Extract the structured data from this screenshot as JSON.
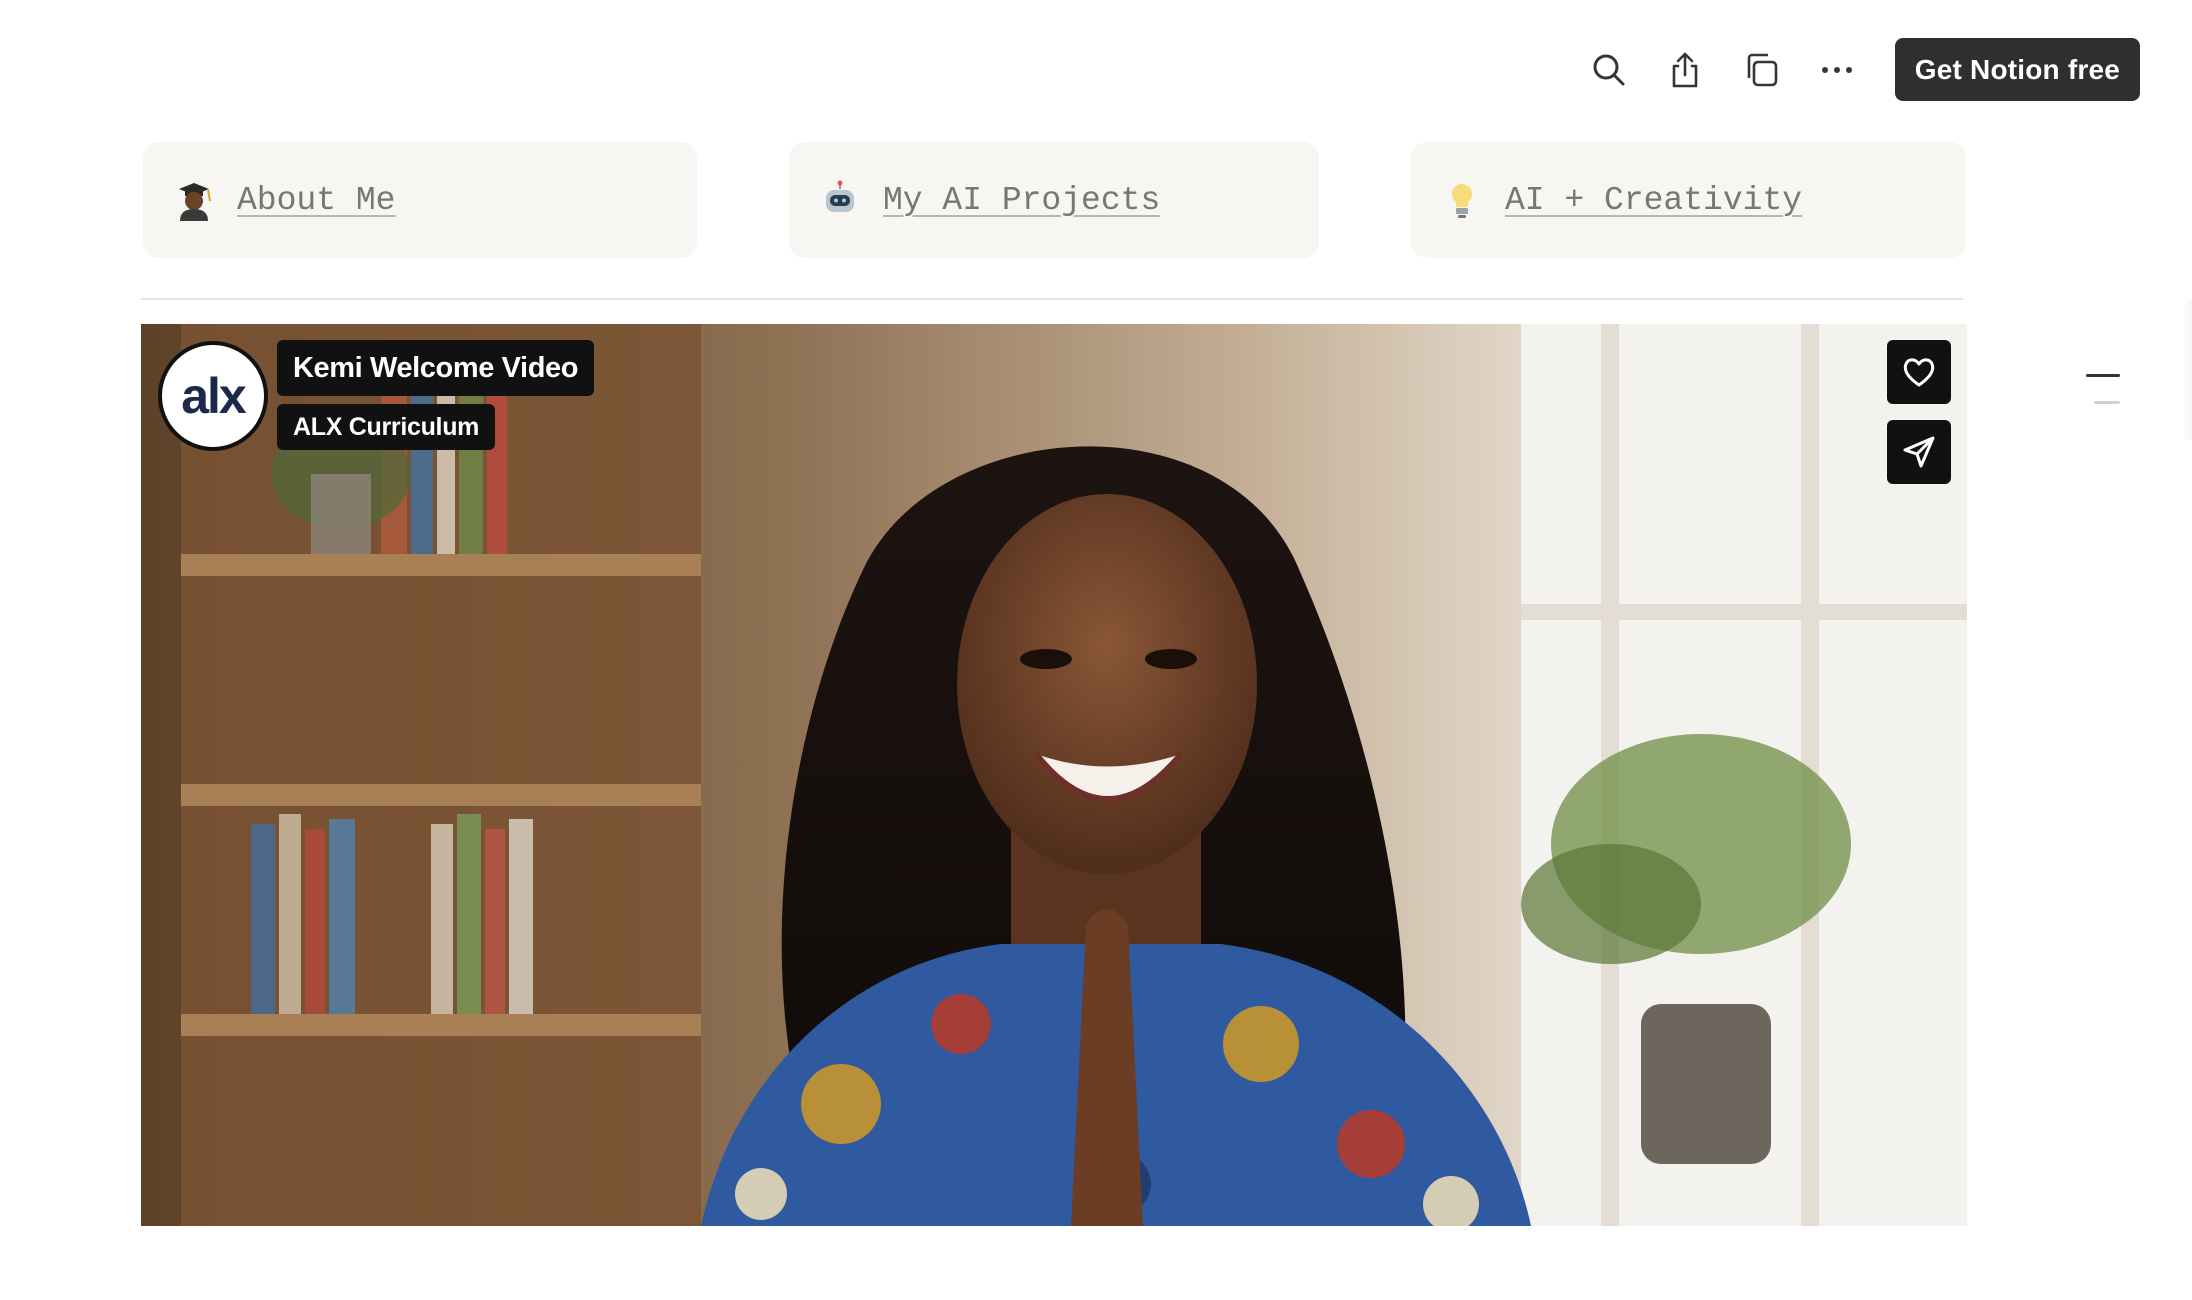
{
  "topbar": {
    "icons": [
      "search-icon",
      "share-icon",
      "duplicate-icon",
      "more-icon"
    ],
    "cta_label": "Get Notion free"
  },
  "cards": [
    {
      "emoji": "student-emoji",
      "label": "About Me"
    },
    {
      "emoji": "robot-emoji",
      "label": "My AI Projects"
    },
    {
      "emoji": "lightbulb-emoji",
      "label": "AI + Creativity"
    }
  ],
  "video": {
    "channel_logo_text": "alx",
    "title": "Kemi Welcome Video",
    "channel": "ALX Curriculum",
    "actions": [
      "heart-icon",
      "send-icon"
    ]
  }
}
